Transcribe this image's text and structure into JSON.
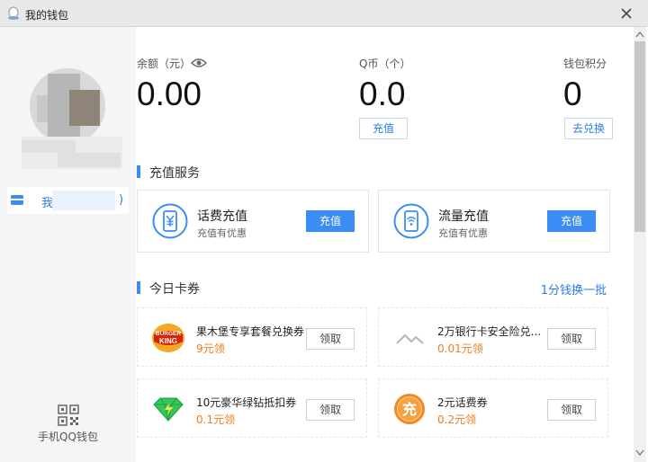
{
  "window": {
    "title": "我的钱包"
  },
  "sidebar": {
    "nav_label": "我",
    "nav_paren": ")",
    "qr_label": "手机QQ钱包"
  },
  "stats": {
    "balance_label": "余额（元）",
    "balance_value": "0.00",
    "qcoin_label": "Q币（个）",
    "qcoin_value": "0.0",
    "qcoin_button": "充值",
    "points_label": "钱包积分",
    "points_value": "0",
    "points_button": "去兑换"
  },
  "recharge": {
    "section_title": "充值服务",
    "cards": [
      {
        "title": "话费充值",
        "subtitle": "充值有优惠",
        "button": "充值",
        "icon": "yuan-phone-icon"
      },
      {
        "title": "流量充值",
        "subtitle": "充值有优惠",
        "button": "充值",
        "icon": "wifi-phone-icon"
      }
    ]
  },
  "coupons": {
    "section_title": "今日卡券",
    "refresh_link": "1分钱换一批",
    "items": [
      {
        "title": "果木堡专享套餐兑换券",
        "price": "9元领",
        "button": "领取",
        "icon": "burger-king-logo"
      },
      {
        "title": "2万银行卡安全险兑...",
        "price": "0.01元领",
        "button": "领取",
        "icon": "mountain-icon"
      },
      {
        "title": "10元豪华绿钻抵扣券",
        "price": "0.1元领",
        "button": "领取",
        "icon": "green-diamond-icon"
      },
      {
        "title": "2元话费券",
        "price": "0.2元领",
        "button": "领取",
        "icon": "orange-coin-icon"
      }
    ]
  },
  "colors": {
    "accent": "#3b8cf5",
    "price": "#f07c1e",
    "sidebar_bg": "#f4f5f7"
  }
}
